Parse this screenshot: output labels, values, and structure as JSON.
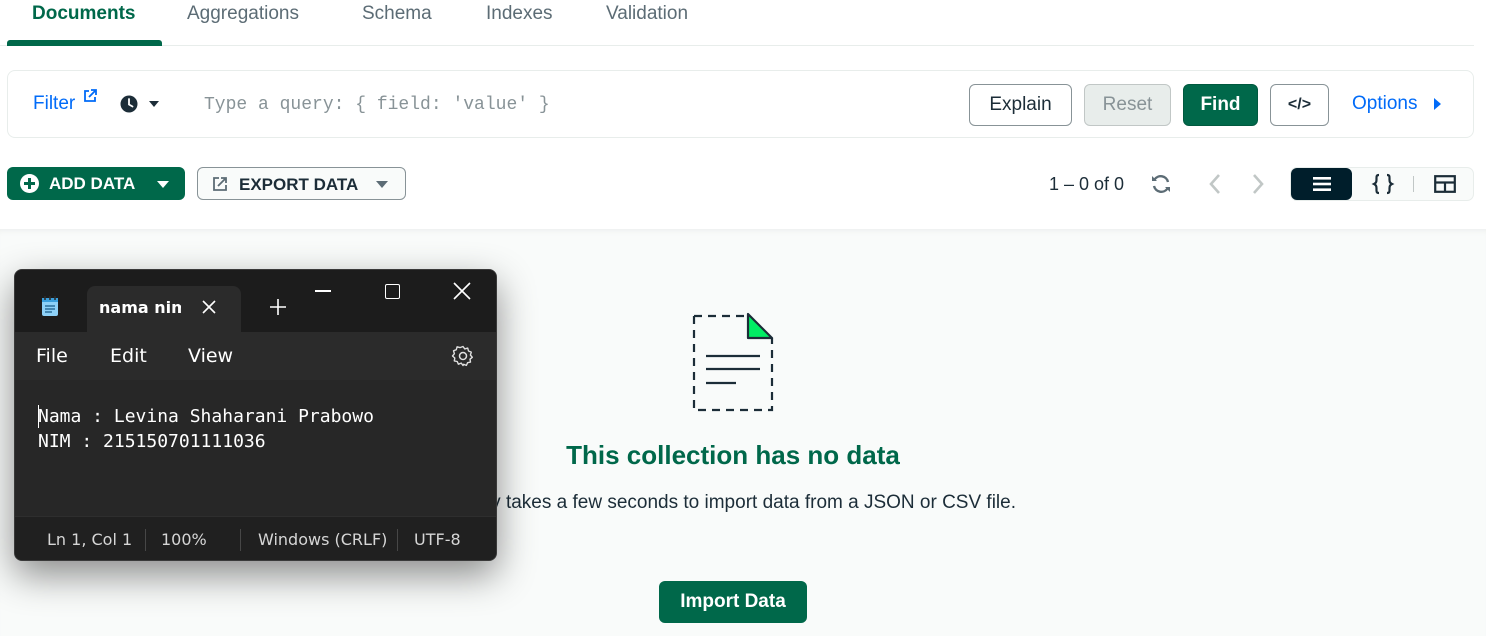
{
  "tabs": [
    {
      "label": "Documents",
      "active": true
    },
    {
      "label": "Aggregations"
    },
    {
      "label": "Schema"
    },
    {
      "label": "Indexes"
    },
    {
      "label": "Validation"
    }
  ],
  "querybar": {
    "filter_label": "Filter",
    "query_placeholder": "Type a query: { field: 'value' }",
    "explain": "Explain",
    "reset": "Reset",
    "find": "Find",
    "code_label": "</>",
    "options": "Options"
  },
  "toolbar": {
    "add_data": "ADD DATA",
    "export_data": "EXPORT DATA",
    "pagination": "1 – 0 of 0"
  },
  "empty_state": {
    "title": "This collection has no data",
    "description": "It only takes a few seconds to import data from a JSON or CSV file.",
    "import_button": "Import Data"
  },
  "notepad": {
    "tab_title": "nama nim",
    "menu": {
      "file": "File",
      "edit": "Edit",
      "view": "View"
    },
    "content_line1": "Nama : Levina Shaharani Prabowo",
    "content_line2": "NIM : 215150701111036",
    "status": {
      "position": "Ln 1, Col 1",
      "zoom": "100%",
      "line_ending": "Windows (CRLF)",
      "encoding": "UTF-8"
    }
  },
  "colors": {
    "brand_green": "#00684a",
    "link_blue": "#016bf8",
    "dark_navy": "#001e2b"
  }
}
